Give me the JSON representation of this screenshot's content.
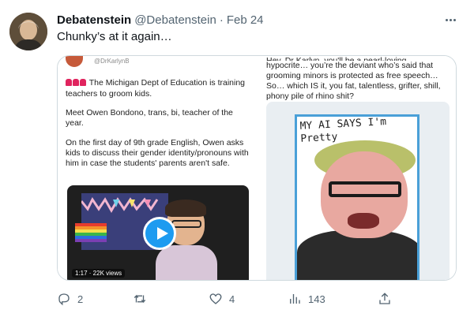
{
  "tweet": {
    "display_name": "Debatenstein",
    "handle": "@Debatenstein",
    "separator": "·",
    "date": "Feb 24",
    "text": "Chunky’s at it again…"
  },
  "quoted_left": {
    "handle": "@DrKarlynB",
    "paragraph1": "The Michigan Dept of Education is training teachers to groom kids.",
    "paragraph2": "Meet Owen Bondono, trans, bi, teacher of the year.",
    "paragraph3": "On the first day of 9th grade English, Owen asks kids to discuss their gender identity/pronouns with him in case the students' parents aren't safe.",
    "video_meta": "1:17 · 22K views"
  },
  "quoted_right": {
    "clipped_line": "Hey, Dr Karlyn, you'll be a pearl-loving",
    "line1": "hypocrite… you’re the deviant who’s said that",
    "line2": "grooming minors is protected as free speech…",
    "line3": "So… which IS it, you fat, talentless, grifter, shill,",
    "line4": "phony pile of rhino shit?",
    "art_caption_line1": "MY AI SAYS I'm",
    "art_caption_line2": "Pretty"
  },
  "actions": {
    "reply_count": "2",
    "retweet_count": "",
    "like_count": "4",
    "views_count": "143"
  },
  "icons": {
    "reply": "reply-icon",
    "retweet": "retweet-icon",
    "like": "heart-icon",
    "views": "views-icon",
    "share": "share-icon",
    "more": "more-icon",
    "play": "play-icon"
  }
}
